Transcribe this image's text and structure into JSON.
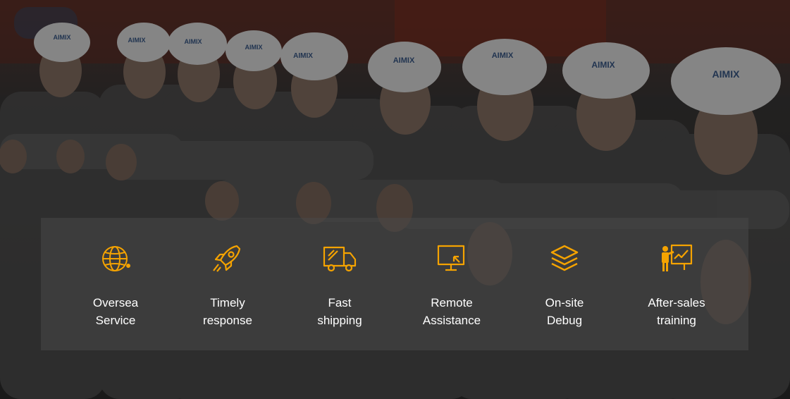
{
  "colors": {
    "accent": "#f5a300",
    "panel": "#484848",
    "text": "#ffffff"
  },
  "photo": {
    "helmet_logo": "AIMIX"
  },
  "features": [
    {
      "icon": "globe-icon",
      "label": "Oversea\nService"
    },
    {
      "icon": "rocket-icon",
      "label": "Timely\nresponse"
    },
    {
      "icon": "truck-icon",
      "label": "Fast\nshipping"
    },
    {
      "icon": "monitor-icon",
      "label": "Remote\nAssistance"
    },
    {
      "icon": "layers-icon",
      "label": "On-site\nDebug"
    },
    {
      "icon": "presentation-icon",
      "label": "After-sales\ntraining"
    }
  ]
}
